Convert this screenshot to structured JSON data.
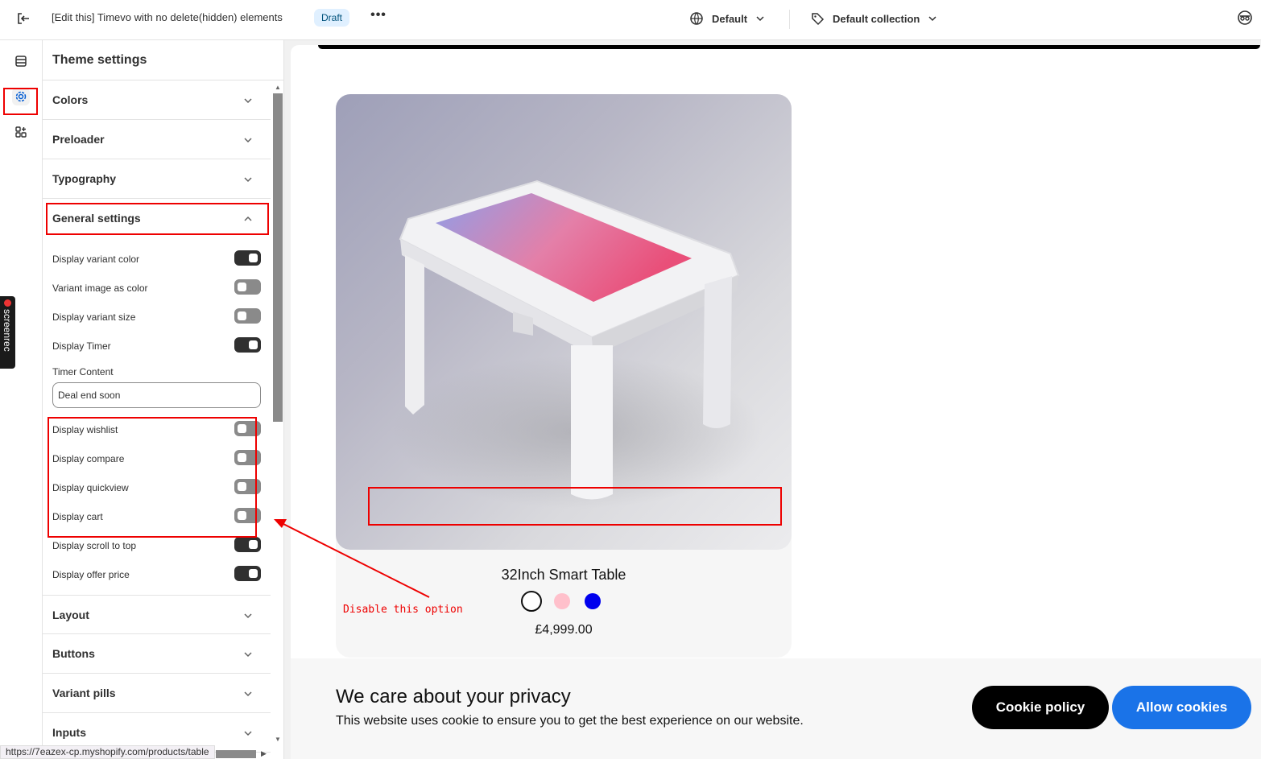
{
  "topbar": {
    "title": "[Edit this] Timevo with no delete(hidden) elements",
    "badge": "Draft",
    "more": "•••",
    "theme_select": "Default",
    "collection_select": "Default collection"
  },
  "panel": {
    "title": "Theme settings",
    "sections_top": [
      {
        "label": "Colors"
      },
      {
        "label": "Preloader"
      },
      {
        "label": "Typography"
      }
    ],
    "general": {
      "label": "General settings",
      "toggles": [
        {
          "label": "Display variant color",
          "on": true
        },
        {
          "label": "Variant image as color",
          "on": false
        },
        {
          "label": "Display variant size",
          "on": false
        },
        {
          "label": "Display Timer",
          "on": true
        }
      ],
      "timer_label": "Timer Content",
      "timer_value": "Deal end soon",
      "toggles2": [
        {
          "label": "Display wishlist",
          "on": false
        },
        {
          "label": "Display compare",
          "on": false
        },
        {
          "label": "Display quickview",
          "on": false
        },
        {
          "label": "Display cart",
          "on": false
        },
        {
          "label": "Display scroll to top",
          "on": true
        },
        {
          "label": "Display offer price",
          "on": true
        }
      ]
    },
    "sections_bottom": [
      {
        "label": "Layout"
      },
      {
        "label": "Buttons"
      },
      {
        "label": "Variant pills"
      },
      {
        "label": "Inputs"
      }
    ]
  },
  "screenrec": "screenrec",
  "status_url": "https://7eazex-cp.myshopify.com/products/table",
  "product": {
    "name": "32Inch Smart Table",
    "price": "£4,999.00",
    "swatches": [
      "#ffffff",
      "#ffc0cb",
      "#0000ee"
    ]
  },
  "annotation": "Disable this option",
  "cookie": {
    "heading": "We care about your privacy",
    "text": "This website uses cookie to ensure you to get the best experience on our website.",
    "policy_button": "Cookie policy",
    "allow_button": "Allow cookies"
  },
  "colors": {
    "accent_blue": "#1a73e8",
    "annotation_red": "#ee0000"
  }
}
